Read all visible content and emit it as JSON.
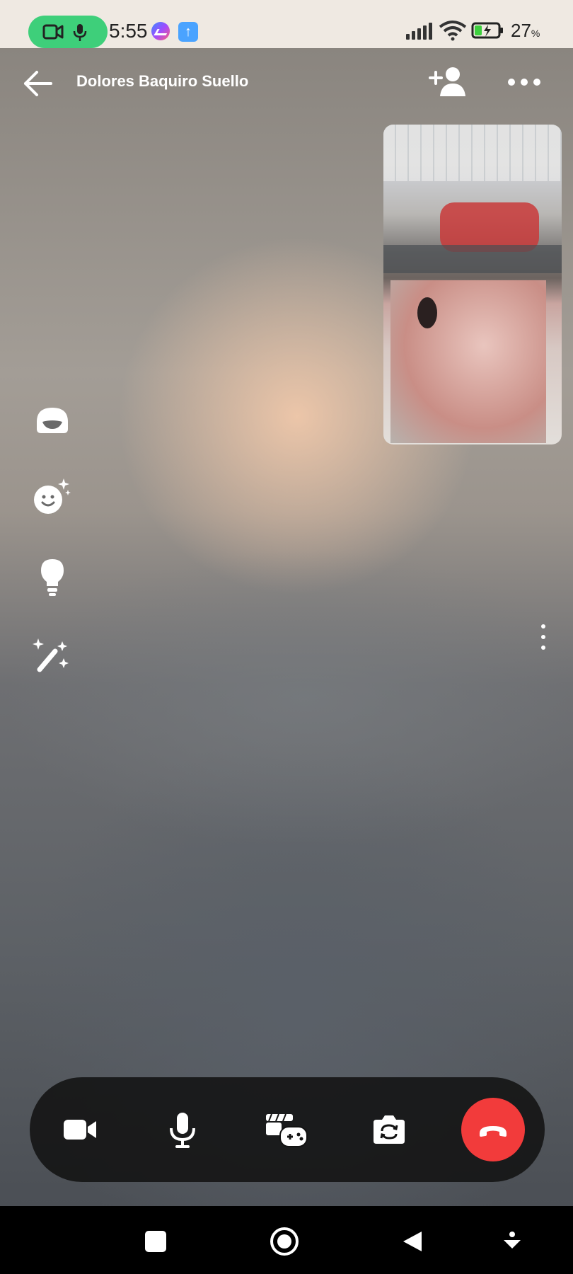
{
  "status_bar": {
    "time": "5:55",
    "battery_percent": "27",
    "battery_unit": "%",
    "icons": [
      "video-call-active-icon",
      "mic-active-icon",
      "messenger-icon",
      "upload-icon",
      "signal-icon",
      "wifi-icon",
      "battery-charging-icon"
    ]
  },
  "call": {
    "caller_name": "Dolores Baquiro Suello"
  },
  "top_actions": {
    "back": "back-arrow-icon",
    "add_person": "add-person-icon",
    "more": "more-horizontal-icon"
  },
  "side_tools": [
    {
      "name": "avatar-effect",
      "icon": "avatar-face-icon"
    },
    {
      "name": "effects",
      "icon": "sparkle-face-icon"
    },
    {
      "name": "lighting",
      "icon": "lightbulb-icon"
    },
    {
      "name": "magic",
      "icon": "magic-wand-icon"
    }
  ],
  "controls": {
    "buttons": [
      {
        "name": "camera",
        "icon": "video-camera-icon"
      },
      {
        "name": "microphone",
        "icon": "microphone-icon"
      },
      {
        "name": "games",
        "icon": "games-icon"
      },
      {
        "name": "flip-camera",
        "icon": "flip-camera-icon"
      },
      {
        "name": "end-call",
        "icon": "hang-up-icon"
      }
    ],
    "end_color": "#f23b3b"
  },
  "nav": [
    "recents-icon",
    "home-icon",
    "back-icon",
    "assist-icon"
  ],
  "colors": {
    "call_pill": "#3ecf7a",
    "status_bg": "#efe9e2",
    "control_bar": "#121212"
  }
}
